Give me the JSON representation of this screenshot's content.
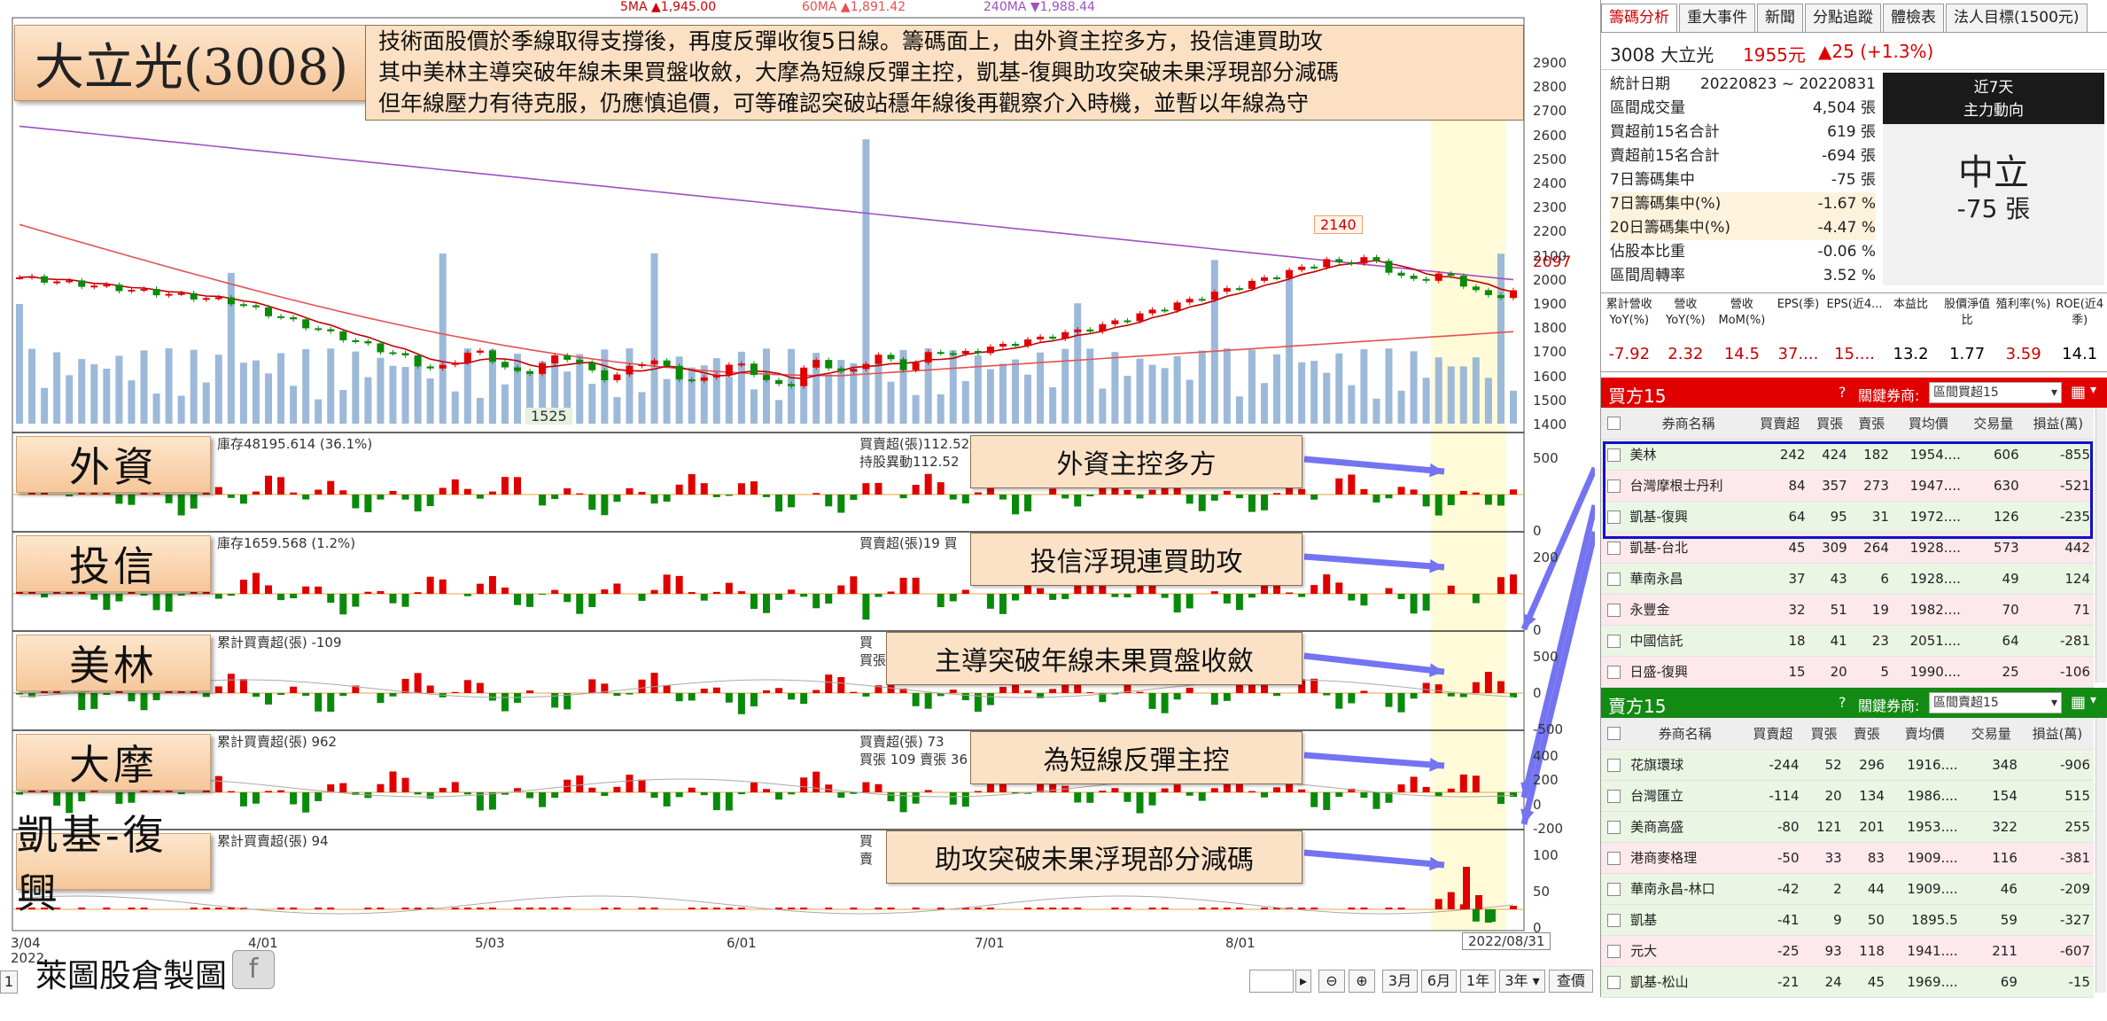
{
  "title": "大立光(3008)",
  "note_lines": [
    "技術面股價於季線取得支撐後，再度反彈收復5日線。籌碼面上，由外資主控多方，投信連買助攻",
    "其中美林主導突破年線未果買盤收斂，大摩為短線反彈主控，凱基-復興助攻突破未果浮現部分減碼",
    "但年線壓力有待克服，仍應慎追價，可等確認突破站穩年線後再觀察介入時機，並暫以年線為守"
  ],
  "legend": {
    "ma5": "5MA ▲1,945.00",
    "ma60": "60MA ▲1,891.42",
    "ma240": "240MA ▼1,988.44"
  },
  "colors": {
    "up": "#e00000",
    "down": "#0a8a0a",
    "ma5": "#c00000",
    "ma60": "#e65050",
    "ma240": "#a050c0",
    "vol": "#9db9d9",
    "highlight": "#fffbd8"
  },
  "price_labels": {
    "high": "2140",
    "low": "1525",
    "last": "2097"
  },
  "y_ticks": [
    "2900",
    "2800",
    "2700",
    "2600",
    "2500",
    "2400",
    "2300",
    "2200",
    "2100",
    "2000",
    "1900",
    "1800",
    "1700",
    "1600",
    "1500",
    "1400"
  ],
  "x_labels": [
    "3/04",
    "4/01",
    "5/03",
    "6/01",
    "7/01",
    "8/01",
    "2022/08/31"
  ],
  "x_year": "2022",
  "panels": [
    {
      "label": "外資",
      "info": "庫存48195.614 (36.1%)",
      "info2": "買賣超(張)112.52",
      "info3": "持股異動112.52",
      "callout": "外資主控多方",
      "ticks": [
        "500",
        "0"
      ]
    },
    {
      "label": "投信",
      "info": "庫存1659.568 (1.2%)",
      "info2": "買賣超(張)19 買",
      "info3": "",
      "callout": "投信浮現連買助攻",
      "ticks": [
        "200",
        "0"
      ]
    },
    {
      "label": "美林",
      "info": "累計買賣超(張) -109",
      "info2": "買",
      "info3": "買張",
      "callout": "主導突破年線未果買盤收斂",
      "ticks": [
        "500",
        "0",
        "-500"
      ]
    },
    {
      "label": "大摩",
      "info": "累計買賣超(張) 962",
      "info2": "買賣超(張) 73",
      "info3": "買張 109 賣張 36",
      "callout": "為短線反彈主控",
      "ticks": [
        "400",
        "200",
        "0",
        "-200"
      ]
    },
    {
      "label": "凱基-復興",
      "info": "累計買賣超(張) 94",
      "info2": "買",
      "info3": "賣",
      "callout": "助攻突破未果浮現部分減碼",
      "ticks": [
        "100",
        "50",
        "0"
      ]
    }
  ],
  "toolbar": {
    "r3m": "3月",
    "r6m": "6月",
    "r1y": "1年",
    "r3y": "3年",
    "query": "查價",
    "page": "1"
  },
  "footer": "萊圖股倉製圖",
  "right": {
    "tabs": [
      "籌碼分析",
      "重大事件",
      "新聞",
      "分點追蹤",
      "體檢表",
      "法人目標(1500元)"
    ],
    "quote": {
      "name": "3008 大立光",
      "price": "1955元",
      "change": "▲25 (+1.3%)"
    },
    "stats": [
      {
        "k": "統計日期",
        "v": "20220823 ~ 20220831"
      },
      {
        "k": "區間成交量",
        "v": "4,504 張"
      },
      {
        "k": "買超前15名合計",
        "v": "619 張"
      },
      {
        "k": "賣超前15名合計",
        "v": "-694 張"
      },
      {
        "k": "7日籌碼集中",
        "v": "-75 張"
      },
      {
        "k": "7日籌碼集中(%)",
        "v": "-1.67 %"
      },
      {
        "k": "20日籌碼集中(%)",
        "v": "-4.47 %"
      },
      {
        "k": "佔股本比重",
        "v": "-0.06 %"
      },
      {
        "k": "區間周轉率",
        "v": "3.52 %"
      }
    ],
    "trend": {
      "head1": "近7天",
      "head2": "主力動向",
      "state": "中立",
      "amount": "-75 張"
    },
    "fund_heads": [
      "累計營收YoY(%)",
      "營收YoY(%)",
      "營收MoM(%)",
      "EPS(季)",
      "EPS(近4...",
      "本益比",
      "股價淨值比",
      "殖利率(%)",
      "ROE(近4季)"
    ],
    "fund_vals": [
      "-7.92",
      "2.32",
      "14.5",
      "37....",
      "15....",
      "13.2",
      "1.77",
      "3.59",
      "14.1"
    ],
    "buy_title": "買方15",
    "sell_title": "賣方15",
    "broker_label": "關鍵券商:",
    "buy_select": "區間買超15",
    "sell_select": "區間賣超15",
    "buy_cols": [
      "券商名稱",
      "買賣超",
      "買張",
      "賣張",
      "買均價",
      "交易量",
      "損益(萬)"
    ],
    "sell_cols": [
      "券商名稱",
      "買賣超",
      "買張",
      "賣張",
      "賣均價",
      "交易量",
      "損益(萬)"
    ],
    "buy_rows": [
      [
        "美林",
        "242",
        "424",
        "182",
        "1954....",
        "606",
        "-855"
      ],
      [
        "台灣摩根士丹利",
        "84",
        "357",
        "273",
        "1947....",
        "630",
        "-521"
      ],
      [
        "凱基-復興",
        "64",
        "95",
        "31",
        "1972....",
        "126",
        "-235"
      ],
      [
        "凱基-台北",
        "45",
        "309",
        "264",
        "1928....",
        "573",
        "442"
      ],
      [
        "華南永昌",
        "37",
        "43",
        "6",
        "1928....",
        "49",
        "124"
      ],
      [
        "永豐金",
        "32",
        "51",
        "19",
        "1982....",
        "70",
        "71"
      ],
      [
        "中國信託",
        "18",
        "41",
        "23",
        "2051....",
        "64",
        "-281"
      ],
      [
        "日盛-復興",
        "15",
        "20",
        "5",
        "1990....",
        "25",
        "-106"
      ]
    ],
    "sell_rows": [
      [
        "花旗環球",
        "-244",
        "52",
        "296",
        "1916....",
        "348",
        "-906"
      ],
      [
        "台灣匯立",
        "-114",
        "20",
        "134",
        "1986....",
        "154",
        "515"
      ],
      [
        "美商高盛",
        "-80",
        "121",
        "201",
        "1953....",
        "322",
        "255"
      ],
      [
        "港商麥格理",
        "-50",
        "33",
        "83",
        "1909....",
        "116",
        "-381"
      ],
      [
        "華南永昌-林口",
        "-42",
        "2",
        "44",
        "1909....",
        "46",
        "-209"
      ],
      [
        "凱基",
        "-41",
        "9",
        "50",
        "1895.5",
        "59",
        "-327"
      ],
      [
        "元大",
        "-25",
        "93",
        "118",
        "1941....",
        "211",
        "-607"
      ],
      [
        "凱基-松山",
        "-21",
        "24",
        "45",
        "1969....",
        "69",
        "-15"
      ]
    ]
  }
}
